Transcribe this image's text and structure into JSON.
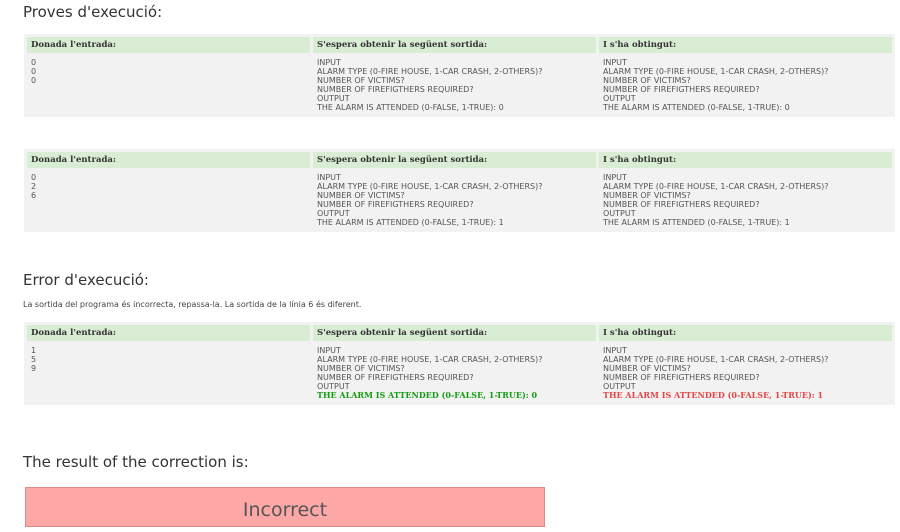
{
  "section_tests_title": "Proves d'execució:",
  "headers": {
    "input": "Donada l'entrada:",
    "expected": "S'espera obtenir la següent sortida:",
    "obtained": "I s'ha obtingut:"
  },
  "tests": [
    {
      "input": [
        "0",
        "0",
        "0"
      ],
      "expected": [
        "INPUT",
        "ALARM TYPE (0-FIRE HOUSE, 1-CAR CRASH, 2-OTHERS)?",
        "NUMBER OF VICTIMS?",
        "NUMBER OF FIREFIGTHERS REQUIRED?",
        "OUTPUT",
        "THE ALARM IS ATTENDED (0-FALSE, 1-TRUE): 0"
      ],
      "obtained": [
        "INPUT",
        "ALARM TYPE (0-FIRE HOUSE, 1-CAR CRASH, 2-OTHERS)?",
        "NUMBER OF VICTIMS?",
        "NUMBER OF FIREFIGTHERS REQUIRED?",
        "OUTPUT",
        "THE ALARM IS ATTENDED (0-FALSE, 1-TRUE): 0"
      ]
    },
    {
      "input": [
        "0",
        "2",
        "6"
      ],
      "expected": [
        "INPUT",
        "ALARM TYPE (0-FIRE HOUSE, 1-CAR CRASH, 2-OTHERS)?",
        "NUMBER OF VICTIMS?",
        "NUMBER OF FIREFIGTHERS REQUIRED?",
        "OUTPUT",
        "THE ALARM IS ATTENDED (0-FALSE, 1-TRUE): 1"
      ],
      "obtained": [
        "INPUT",
        "ALARM TYPE (0-FIRE HOUSE, 1-CAR CRASH, 2-OTHERS)?",
        "NUMBER OF VICTIMS?",
        "NUMBER OF FIREFIGTHERS REQUIRED?",
        "OUTPUT",
        "THE ALARM IS ATTENDED (0-FALSE, 1-TRUE): 1"
      ]
    }
  ],
  "section_error_title": "Error d'execució:",
  "error_note": "La sortida del programa és incorrecta, repassa-la. La sortida de la línia 6 és diferent.",
  "error_test": {
    "input": [
      "1",
      "5",
      "9"
    ],
    "expected": [
      "INPUT",
      "ALARM TYPE (0-FIRE HOUSE, 1-CAR CRASH, 2-OTHERS)?",
      "NUMBER OF VICTIMS?",
      "NUMBER OF FIREFIGTHERS REQUIRED?",
      "OUTPUT",
      "THE ALARM IS ATTENDED (0-FALSE, 1-TRUE): 0"
    ],
    "obtained": [
      "INPUT",
      "ALARM TYPE (0-FIRE HOUSE, 1-CAR CRASH, 2-OTHERS)?",
      "NUMBER OF VICTIMS?",
      "NUMBER OF FIREFIGTHERS REQUIRED?",
      "OUTPUT",
      "THE ALARM IS ATTENDED (0-FALSE, 1-TRUE): 1"
    ],
    "diff_line_index": 5
  },
  "result_label": "The result of the correction is:",
  "result_value": "Incorrect",
  "colors": {
    "header_bg": "#d9ecd4",
    "cell_bg": "#f2f2f2",
    "expected_diff": "#139e13",
    "obtained_diff": "#e54545",
    "result_bg": "#fda7a7"
  }
}
